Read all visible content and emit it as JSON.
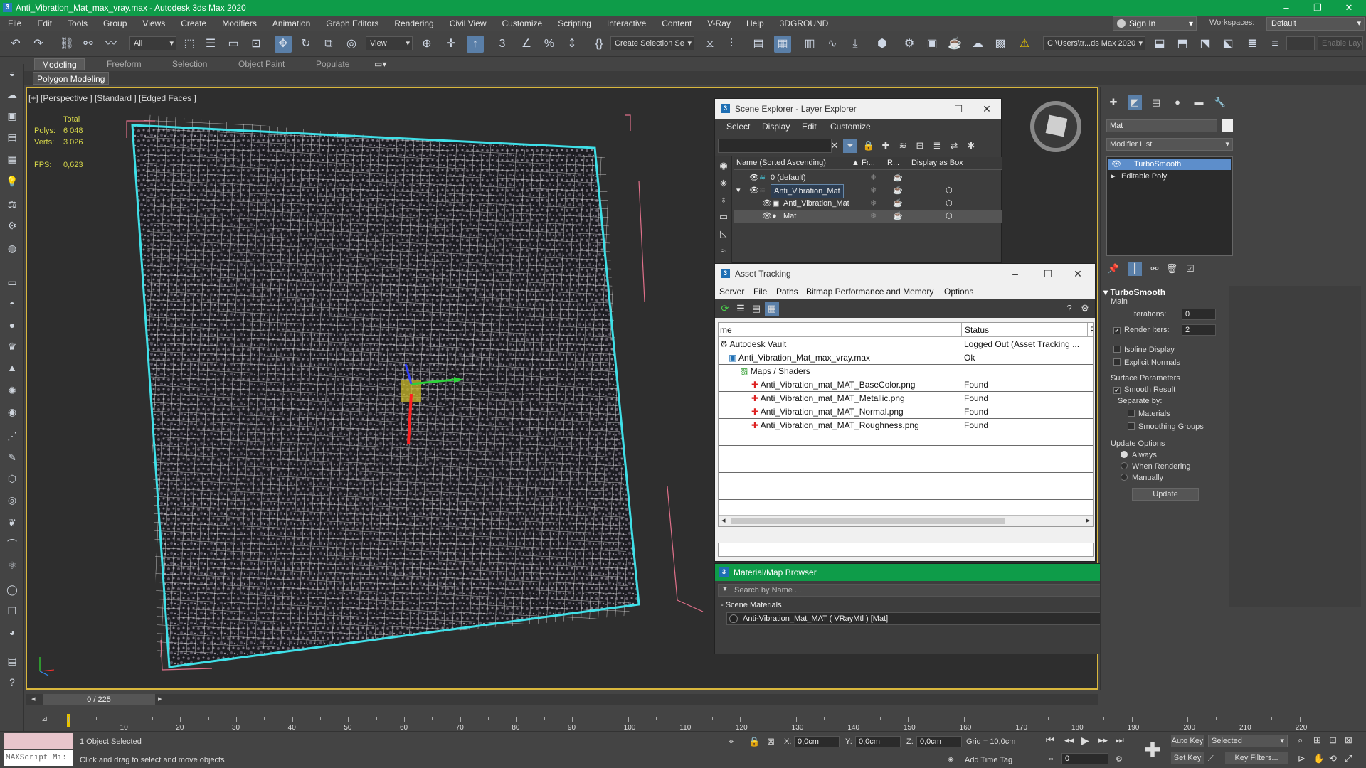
{
  "window": {
    "title": "Anti_Vibration_Mat_max_vray.max - Autodesk 3ds Max 2020"
  },
  "menu": [
    "File",
    "Edit",
    "Tools",
    "Group",
    "Views",
    "Create",
    "Modifiers",
    "Animation",
    "Graph Editors",
    "Rendering",
    "Civil View",
    "Customize",
    "Scripting",
    "Interactive",
    "Content",
    "V-Ray",
    "Help",
    "3DGROUND"
  ],
  "account": {
    "sign_in": "Sign In",
    "workspaces_label": "Workspaces:",
    "workspace": "Default"
  },
  "toolbar": {
    "filter": "All",
    "ref_coord": "View",
    "selection_set": "Create Selection Se",
    "project_path": "C:\\Users\\tr...ds Max 2020",
    "enable_layer": "Enable Laye"
  },
  "ribbon": {
    "tabs": [
      "Modeling",
      "Freeform",
      "Selection",
      "Object Paint",
      "Populate"
    ],
    "sub": "Polygon Modeling"
  },
  "viewport": {
    "label": "[+] [Perspective ] [Standard ] [Edged Faces ]",
    "stats": {
      "total": "Total",
      "polys_label": "Polys:",
      "polys": "6 048",
      "verts_label": "Verts:",
      "verts": "3 026",
      "fps_label": "FPS:",
      "fps": "0,623"
    }
  },
  "scene_explorer": {
    "title": "Scene Explorer - Layer Explorer",
    "menu": [
      "Select",
      "Display",
      "Edit",
      "Customize"
    ],
    "columns": {
      "name": "Name (Sorted Ascending)",
      "fr": "Fr...",
      "r": "R...",
      "box": "Display as Box"
    },
    "rows": [
      {
        "name": "0 (default)"
      },
      {
        "name": "Anti_Vibration_Mat"
      },
      {
        "name": "Anti_Vibration_Mat"
      },
      {
        "name": "Mat"
      }
    ]
  },
  "asset_tracking": {
    "title": "Asset Tracking",
    "menu": [
      "Server",
      "File",
      "Paths",
      "Bitmap Performance and Memory",
      "Options"
    ],
    "columns": {
      "name": "me",
      "status": "Status",
      "pr": "Pr"
    },
    "rows": [
      {
        "name": "Autodesk Vault",
        "status": "Logged Out (Asset Tracking ..."
      },
      {
        "name": "Anti_Vibration_Mat_max_vray.max",
        "status": "Ok"
      },
      {
        "name": "Maps / Shaders",
        "status": ""
      },
      {
        "name": "Anti_Vibration_mat_MAT_BaseColor.png",
        "status": "Found"
      },
      {
        "name": "Anti_Vibration_mat_MAT_Metallic.png",
        "status": "Found"
      },
      {
        "name": "Anti_Vibration_mat_MAT_Normal.png",
        "status": "Found"
      },
      {
        "name": "Anti_Vibration_mat_MAT_Roughness.png",
        "status": "Found"
      }
    ]
  },
  "material_browser": {
    "title": "Material/Map Browser",
    "search_placeholder": "Search by Name ...",
    "section": "- Scene Materials",
    "item": "Anti-Vibration_Mat_MAT ( VRayMtl ) [Mat]"
  },
  "command_panel": {
    "object_name": "Mat",
    "modifier_list": "Modifier List",
    "stack": [
      "TurboSmooth",
      "Editable Poly"
    ],
    "rollout": "TurboSmooth",
    "main": "Main",
    "iterations_label": "Iterations:",
    "iterations": "0",
    "render_iters_label": "Render Iters:",
    "render_iters": "2",
    "isoline": "Isoline Display",
    "explicit_normals": "Explicit Normals",
    "surface_params": "Surface Parameters",
    "smooth_result": "Smooth Result",
    "separate_by": "Separate by:",
    "materials": "Materials",
    "smoothing_groups": "Smoothing Groups",
    "update_options": "Update Options",
    "always": "Always",
    "when_rendering": "When Rendering",
    "manually": "Manually",
    "update_button": "Update"
  },
  "timeline": {
    "frame": "0 / 225",
    "ticks": [
      "10",
      "20",
      "30",
      "40",
      "50",
      "60",
      "70",
      "80",
      "90",
      "100",
      "110",
      "120",
      "130",
      "140",
      "150",
      "160",
      "170",
      "180",
      "190",
      "200",
      "210",
      "220"
    ]
  },
  "status": {
    "maxscript": "MAXScript Mi:",
    "selected": "1 Object Selected",
    "prompt": "Click and drag to select and move objects",
    "x_label": "X:",
    "x": "0,0cm",
    "y_label": "Y:",
    "y": "0,0cm",
    "z_label": "Z:",
    "z": "0,0cm",
    "grid": "Grid = 10,0cm",
    "add_time_tag": "Add Time Tag",
    "auto_key": "Auto Key",
    "set_key": "Set Key",
    "selected_dd": "Selected",
    "key_filters": "Key Filters...",
    "frame_field": "0"
  }
}
